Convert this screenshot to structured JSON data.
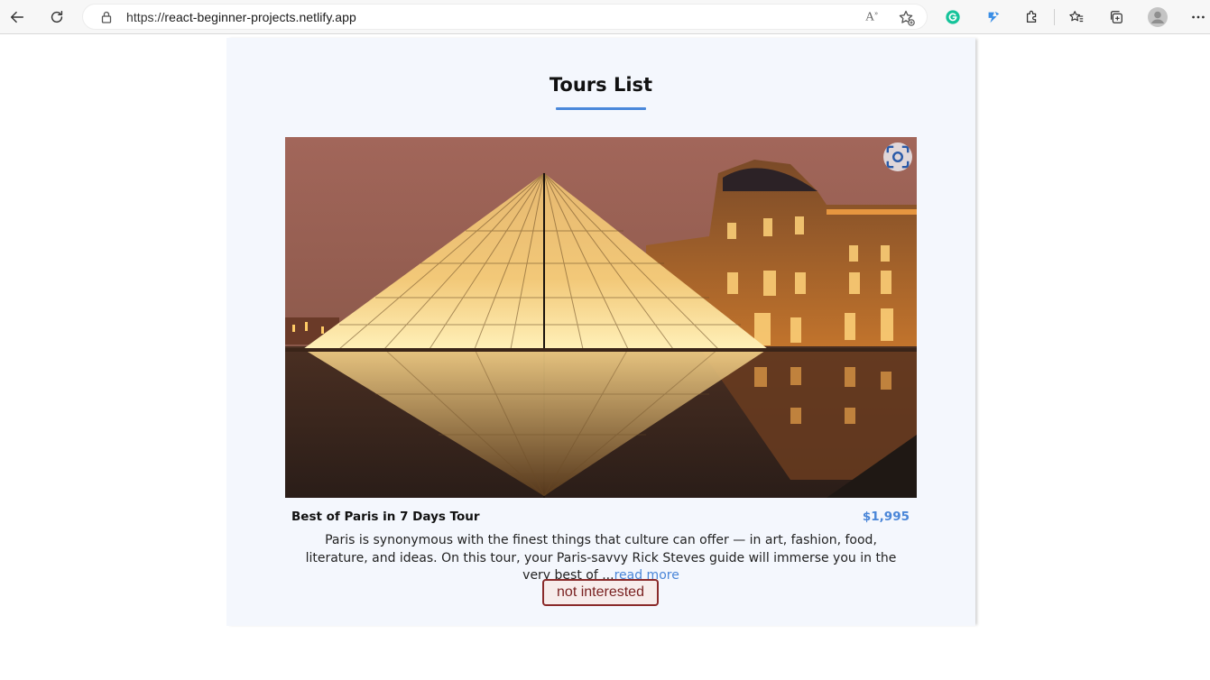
{
  "browser": {
    "url_prefix": "https://",
    "url_host": "react-beginner-projects.netlify.app",
    "read_aloud_glyph": "A",
    "icons": [
      "back-icon",
      "refresh-icon",
      "lock-icon",
      "read-aloud-icon",
      "add-favorite-icon",
      "grammarly-icon",
      "extension-icon",
      "extensions-puzzle-icon",
      "favorites-icon",
      "collections-icon",
      "profile-icon",
      "more-icon"
    ]
  },
  "page": {
    "title": "Tours List",
    "accent_color": "#4a88da"
  },
  "tour": {
    "name": "Best of Paris in 7 Days Tour",
    "price": "$1,995",
    "info": "Paris is synonymous with the finest things that culture can offer — in art, fashion, food, literature, and ideas. On this tour, your Paris-savvy Rick Steves guide will immerse you in the very best of ...",
    "read_more": "read more",
    "not_interested": "not interested"
  }
}
